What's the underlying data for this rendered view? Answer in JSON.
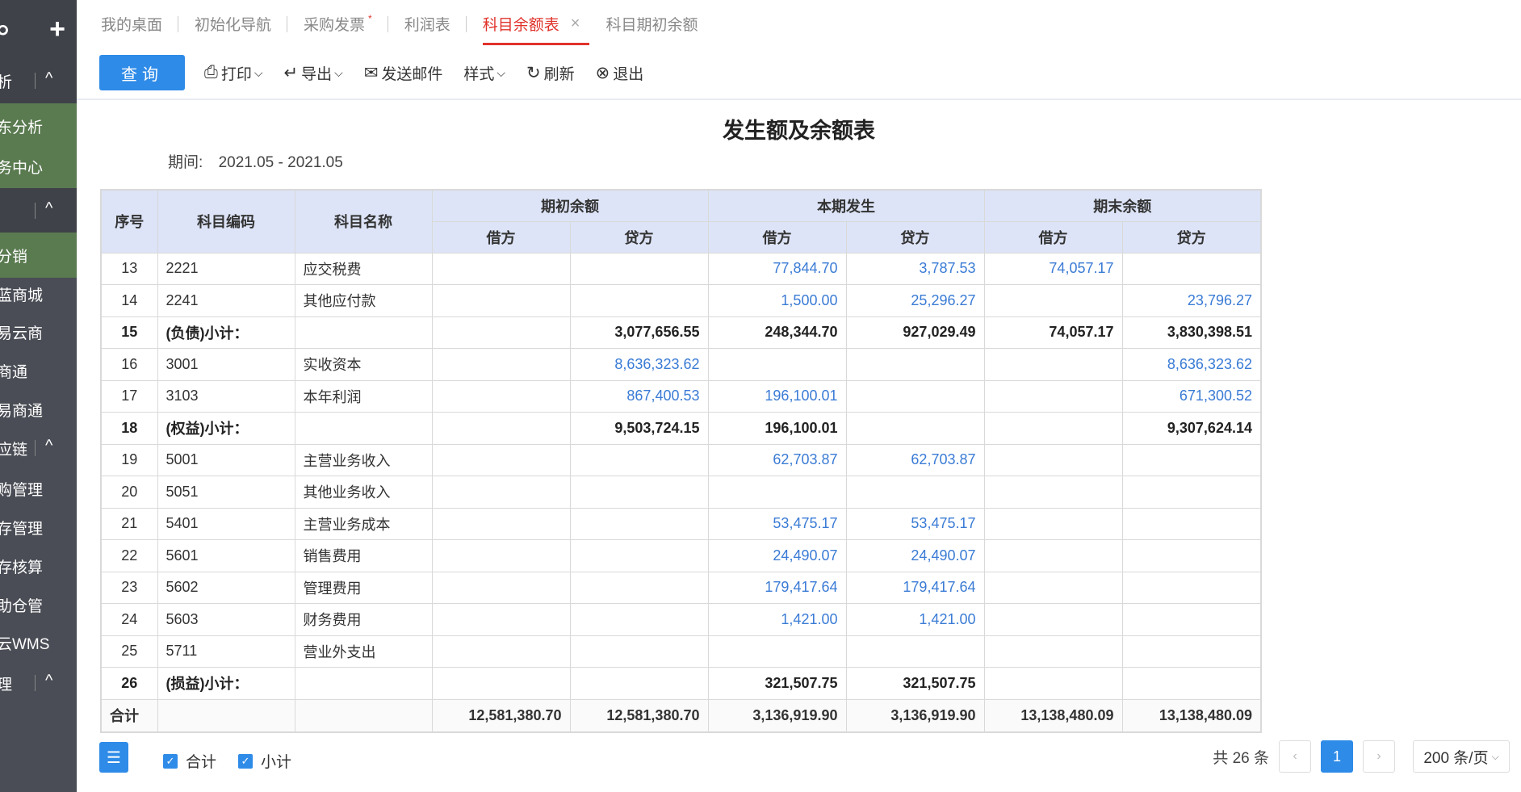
{
  "sidebar": {
    "items": [
      {
        "label": "析",
        "kind": "group",
        "chevron": "^"
      },
      {
        "label": "东分析",
        "kind": "green"
      },
      {
        "label": "务中心",
        "kind": "green"
      },
      {
        "label": "",
        "kind": "group",
        "chevron": "^"
      },
      {
        "label": "分销",
        "kind": "green"
      },
      {
        "label": "蓝商城",
        "kind": "plain"
      },
      {
        "label": "易云商",
        "kind": "plain"
      },
      {
        "label": "商通",
        "kind": "plain"
      },
      {
        "label": "易商通",
        "kind": "plain"
      },
      {
        "label": "应链",
        "kind": "plain",
        "chevron": "^"
      },
      {
        "label": "购管理",
        "kind": "plain"
      },
      {
        "label": "存管理",
        "kind": "plain"
      },
      {
        "label": "存核算",
        "kind": "plain"
      },
      {
        "label": "助仓管",
        "kind": "plain"
      },
      {
        "label": "云WMS",
        "kind": "plain"
      },
      {
        "label": "理",
        "kind": "plain",
        "chevron": "^"
      }
    ]
  },
  "tabs": [
    {
      "label": "我的桌面"
    },
    {
      "label": "初始化导航"
    },
    {
      "label": "采购发票",
      "star": "*"
    },
    {
      "label": "利润表"
    },
    {
      "label": "科目余额表",
      "active": true,
      "close": "×"
    },
    {
      "label": "科目期初余额"
    }
  ],
  "toolbar": {
    "query": "查询",
    "print": "打印",
    "export": "导出",
    "send_mail": "发送邮件",
    "style": "样式",
    "refresh": "刷新",
    "exit": "退出"
  },
  "report": {
    "title": "发生额及余额表",
    "period_label": "期间:",
    "period_value": "2021.05 - 2021.05",
    "headers": {
      "index": "序号",
      "code": "科目编码",
      "name": "科目名称",
      "opening": "期初余额",
      "current": "本期发生",
      "closing": "期末余额",
      "debit": "借方",
      "credit": "贷方"
    },
    "rows": [
      {
        "idx": "13",
        "code": "2221",
        "name": "应交税费",
        "od": "",
        "oc": "",
        "cd": "77,844.70",
        "cc": "3,787.53",
        "ed": "74,057.17",
        "ec": "",
        "bold": false
      },
      {
        "idx": "14",
        "code": "2241",
        "name": "其他应付款",
        "od": "",
        "oc": "",
        "cd": "1,500.00",
        "cc": "25,296.27",
        "ed": "",
        "ec": "23,796.27",
        "bold": false
      },
      {
        "idx": "15",
        "code": "(负债)小计：",
        "name": "",
        "od": "",
        "oc": "3,077,656.55",
        "cd": "248,344.70",
        "cc": "927,029.49",
        "ed": "74,057.17",
        "ec": "3,830,398.51",
        "bold": true
      },
      {
        "idx": "16",
        "code": "3001",
        "name": "实收资本",
        "od": "",
        "oc": "8,636,323.62",
        "cd": "",
        "cc": "",
        "ed": "",
        "ec": "8,636,323.62",
        "bold": false
      },
      {
        "idx": "17",
        "code": "3103",
        "name": "本年利润",
        "od": "",
        "oc": "867,400.53",
        "cd": "196,100.01",
        "cc": "",
        "ed": "",
        "ec": "671,300.52",
        "bold": false
      },
      {
        "idx": "18",
        "code": "(权益)小计：",
        "name": "",
        "od": "",
        "oc": "9,503,724.15",
        "cd": "196,100.01",
        "cc": "",
        "ed": "",
        "ec": "9,307,624.14",
        "bold": true
      },
      {
        "idx": "19",
        "code": "5001",
        "name": "主营业务收入",
        "od": "",
        "oc": "",
        "cd": "62,703.87",
        "cc": "62,703.87",
        "ed": "",
        "ec": "",
        "bold": false
      },
      {
        "idx": "20",
        "code": "5051",
        "name": "其他业务收入",
        "od": "",
        "oc": "",
        "cd": "",
        "cc": "",
        "ed": "",
        "ec": "",
        "bold": false
      },
      {
        "idx": "21",
        "code": "5401",
        "name": "主营业务成本",
        "od": "",
        "oc": "",
        "cd": "53,475.17",
        "cc": "53,475.17",
        "ed": "",
        "ec": "",
        "bold": false
      },
      {
        "idx": "22",
        "code": "5601",
        "name": "销售费用",
        "od": "",
        "oc": "",
        "cd": "24,490.07",
        "cc": "24,490.07",
        "ed": "",
        "ec": "",
        "bold": false
      },
      {
        "idx": "23",
        "code": "5602",
        "name": "管理费用",
        "od": "",
        "oc": "",
        "cd": "179,417.64",
        "cc": "179,417.64",
        "ed": "",
        "ec": "",
        "bold": false
      },
      {
        "idx": "24",
        "code": "5603",
        "name": "财务费用",
        "od": "",
        "oc": "",
        "cd": "1,421.00",
        "cc": "1,421.00",
        "ed": "",
        "ec": "",
        "bold": false
      },
      {
        "idx": "25",
        "code": "5711",
        "name": "营业外支出",
        "od": "",
        "oc": "",
        "cd": "",
        "cc": "",
        "ed": "",
        "ec": "",
        "bold": false
      },
      {
        "idx": "26",
        "code": "(损益)小计：",
        "name": "",
        "od": "",
        "oc": "",
        "cd": "321,507.75",
        "cc": "321,507.75",
        "ed": "",
        "ec": "",
        "bold": true
      }
    ],
    "total": {
      "label": "合计",
      "od": "12,581,380.70",
      "oc": "12,581,380.70",
      "cd": "3,136,919.90",
      "cc": "3,136,919.90",
      "ed": "13,138,480.09",
      "ec": "13,138,480.09"
    }
  },
  "footer": {
    "col_icon": "column-settings-icon",
    "check_total": "合计",
    "check_subtotal": "小计",
    "count_text": "共 26 条",
    "current_page": "1",
    "page_size": "200 条/页"
  },
  "colors": {
    "accent": "#2f8be8",
    "active_tab": "#e0332b",
    "link_value": "#3a7bd5",
    "header_bg": "#dde4f7",
    "sidebar_bg": "#4a4d55",
    "sidebar_green": "#5a7a50"
  }
}
